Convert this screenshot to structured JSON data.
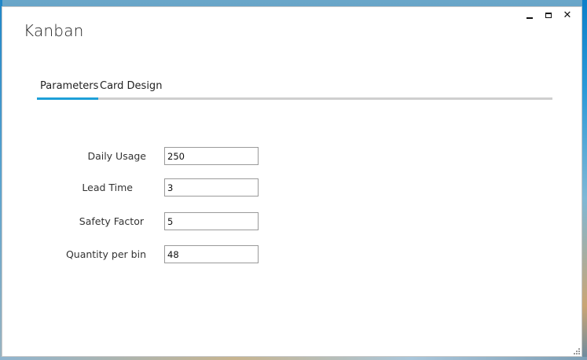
{
  "window": {
    "title": "Kanban",
    "controls": {
      "minimize_icon": "minimize-icon",
      "maximize_icon": "maximize-icon",
      "close_icon": "close-icon",
      "close_glyph": "✕"
    }
  },
  "tabs": [
    {
      "label": "Parameters",
      "active": true
    },
    {
      "label": "Card Design",
      "active": false
    }
  ],
  "form": {
    "fields": [
      {
        "label": "Daily Usage",
        "value": "250"
      },
      {
        "label": "Lead Time",
        "value": "3"
      },
      {
        "label": "Safety Factor",
        "value": "5"
      },
      {
        "label": "Quantity per bin",
        "value": "48"
      }
    ]
  },
  "colors": {
    "accent": "#1e9fd8",
    "tab_strip": "#cfcfcf",
    "window_bg": "#ffffff",
    "input_border": "#9a9a9a"
  }
}
